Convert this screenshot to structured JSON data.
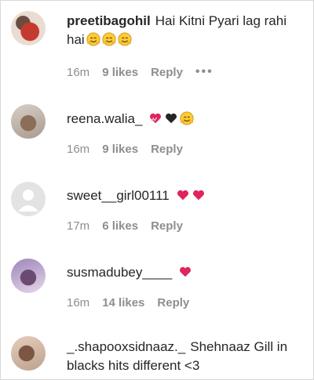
{
  "comments": [
    {
      "username": "preetibagohil",
      "text": "Hai Kitni Pyari lag rahi hai",
      "time": "16m",
      "likes": "9 likes",
      "reply": "Reply",
      "more": "•••",
      "emojis": [
        "smiling-face-with-hands-icon",
        "smiling-face-with-hands-icon",
        "smiling-face-with-hands-icon"
      ]
    },
    {
      "username": "reena.walia_",
      "text": "",
      "time": "16m",
      "likes": "9 likes",
      "reply": "Reply",
      "emojis": [
        "heart-with-ribbon-icon",
        "black-heart-icon",
        "smiling-face-with-hands-icon"
      ]
    },
    {
      "username": "sweet__girl00111",
      "text": "",
      "time": "17m",
      "likes": "6 likes",
      "reply": "Reply",
      "emojis": [
        "red-heart-icon",
        "red-heart-icon"
      ]
    },
    {
      "username": "susmadubey____",
      "text": "",
      "time": "16m",
      "likes": "14 likes",
      "reply": "Reply",
      "emojis": [
        "red-heart-icon"
      ]
    },
    {
      "username": "_.shapooxsidnaaz._",
      "text": "Shehnaaz Gill in blacks hits different <3",
      "emojis": []
    }
  ],
  "colors": {
    "text": "#262626",
    "meta": "#8e8e8e",
    "heart": "#e0245e"
  }
}
